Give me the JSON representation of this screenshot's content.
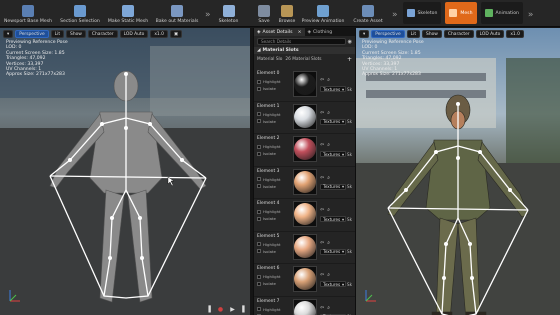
{
  "toolbar_left": {
    "buttons": [
      {
        "label": "Newsport Base Mesh",
        "icon": "mesh-icon",
        "color": "#5a7fb3"
      },
      {
        "label": "Section Selection",
        "icon": "section-icon",
        "color": "#6a9ad0"
      },
      {
        "label": "Make Static Mesh",
        "icon": "static-mesh-icon",
        "color": "#7ea7d8"
      },
      {
        "label": "Bake out Materials",
        "icon": "bake-icon",
        "color": "#7b98c2"
      },
      {
        "label": "Skeleton",
        "icon": "skeleton-icon",
        "color": "#8fb0d8"
      }
    ]
  },
  "toolbar_right": {
    "buttons": [
      {
        "label": "Save",
        "icon": "save-icon",
        "color": "#7e8ca0"
      },
      {
        "label": "Browse",
        "icon": "browse-icon",
        "color": "#b89656"
      },
      {
        "label": "Preview Animation",
        "icon": "preview-animation-icon",
        "color": "#6fa0d0"
      },
      {
        "label": "Create Asset",
        "icon": "create-asset-icon",
        "color": "#6c8db8"
      }
    ],
    "modes": [
      {
        "label": "Skeleton",
        "active": false
      },
      {
        "label": "Mesh",
        "active": true
      },
      {
        "label": "Animation",
        "active": false
      }
    ]
  },
  "viewport_left": {
    "perspective": "Perspective",
    "lit": "Lit",
    "show": "Show",
    "character": "Character",
    "lod": "LOD Auto",
    "speed": "x1.0",
    "stats": [
      "Previewing Reference Pose",
      "LOD: 0",
      "Current Screen Size: 1.85",
      "Triangles: 47,092",
      "Vertices: 33,397",
      "UV Channels: 1",
      "Approx Size: 271x77x283"
    ]
  },
  "viewport_right": {
    "perspective": "Perspective",
    "lit": "Lit",
    "show": "Show",
    "character": "Character",
    "lod": "LOD Auto",
    "speed": "x1.0",
    "stats": [
      "Previewing Reference Pose",
      "LOD: 0",
      "Current Screen Size: 1.85",
      "Triangles: 47,092",
      "Vertices: 33,397",
      "UV Channels: 1",
      "Approx Size: 271x77x283"
    ]
  },
  "panel": {
    "tabs": [
      "Asset Details",
      "Clothing"
    ],
    "search_placeholder": "Search Details",
    "section_title": "Material Slots",
    "slot_label": "Material Slo",
    "slot_count": "26 Material Slots",
    "highlight": "Highlight",
    "isolate": "Isolate",
    "combo_value": "Textures",
    "sk_label": "Sk",
    "elements": [
      {
        "name": "Element 0",
        "ball": "#1b1b1b"
      },
      {
        "name": "Element 1",
        "ball": "#d9dde2"
      },
      {
        "name": "Element 2",
        "ball": "#c24f5c"
      },
      {
        "name": "Element 3",
        "ball": "#e1a273"
      },
      {
        "name": "Element 4",
        "ball": "#f0b387"
      },
      {
        "name": "Element 5",
        "ball": "#e8a983"
      },
      {
        "name": "Element 6",
        "ball": "#d9a176"
      },
      {
        "name": "Element 7",
        "ball": "#dbdbdb"
      }
    ]
  }
}
